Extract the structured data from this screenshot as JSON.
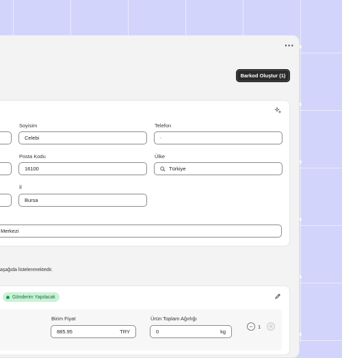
{
  "header": {
    "more_label": "···",
    "barcode_button": "Barkod Oluştur (1)"
  },
  "address": {
    "soyisim_label": "Soyisim",
    "soyisim_value": "Celebi",
    "telefon_label": "Telefon",
    "telefon_value": "-",
    "posta_kodu_label": "Posta Kodu",
    "posta_kodu_value": "16100",
    "ulke_label": "Ülke",
    "ulke_value": "Türkiye",
    "il_label": "İl",
    "il_value": "Bursa",
    "adres_value": "Merkezi"
  },
  "info": {
    "text": "aşağıda listelenmektedir."
  },
  "shipment": {
    "status": "Gönderim Yapılacak",
    "birim_fiyat_label": "Birim Fiyat",
    "birim_fiyat_value": "885.95",
    "currency": "TRY",
    "agirlik_label": "Ürün Toplam Ağırlığı",
    "agirlik_value": "0",
    "agirlik_unit": "kg",
    "quantity": "1",
    "minus": "−",
    "plus": "+"
  },
  "colors": {
    "background": "#d2d4fb",
    "accent_dark": "#2b2b2b",
    "status_green": "#1e9e4d"
  }
}
